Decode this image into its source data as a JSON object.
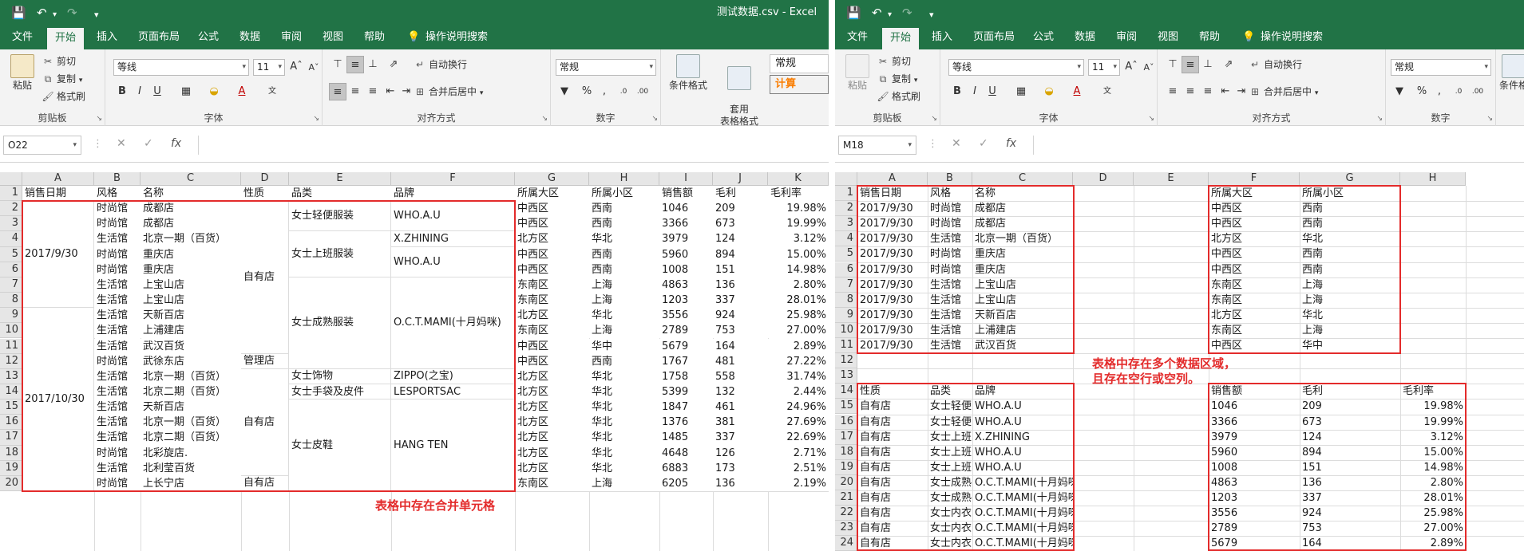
{
  "left": {
    "app_title": "测试数据.csv  -  Excel",
    "tabs": [
      "文件",
      "开始",
      "插入",
      "页面布局",
      "公式",
      "数据",
      "审阅",
      "视图",
      "帮助"
    ],
    "tell_me": "操作说明搜索",
    "clipboard": {
      "paste": "粘贴",
      "cut": "剪切",
      "copy": "复制",
      "painter": "格式刷",
      "label": "剪贴板"
    },
    "font": {
      "name": "等线",
      "size": "11",
      "label": "字体"
    },
    "alignment": {
      "wrap": "自动换行",
      "merge": "合并后居中",
      "label": "对齐方式"
    },
    "number": {
      "format": "常规",
      "label": "数字"
    },
    "styles": {
      "conditional": "条件格式",
      "table": "套用\n表格格式",
      "style1": "常规",
      "style2": "计算"
    },
    "namebox": "O22",
    "columns": [
      "A",
      "B",
      "C",
      "D",
      "E",
      "F",
      "G",
      "H",
      "I",
      "J",
      "K"
    ],
    "rows": [
      "1",
      "2",
      "3",
      "4",
      "5",
      "6",
      "7",
      "8",
      "9",
      "10",
      "11",
      "12",
      "13",
      "14",
      "15",
      "16",
      "17",
      "18",
      "19",
      "20"
    ],
    "headers": [
      "销售日期",
      "风格",
      "名称",
      "性质",
      "品类",
      "品牌",
      "所属大区",
      "所属小区",
      "销售额",
      "毛利",
      "毛利率"
    ],
    "merged_a": [
      "2017/9/30",
      "2017/10/30"
    ],
    "merged_d": [
      "自有店",
      "管理店",
      "自有店",
      "自有店"
    ],
    "merged_e": [
      "女士轻便服装",
      "女士上班服装",
      "女士成熟服装",
      "女士饰物",
      "女士手袋及皮件",
      "女士皮鞋"
    ],
    "merged_f": [
      "WHO.A.U",
      "X.ZHINING",
      "WHO.A.U",
      "O.C.T.MAMI(十月妈咪)",
      "ZIPPO(之宝)",
      "LESPORTSAC",
      "HANG TEN"
    ],
    "style_col": [
      "时尚馆",
      "时尚馆",
      "生活馆",
      "时尚馆",
      "时尚馆",
      "生活馆",
      "生活馆",
      "生活馆",
      "生活馆",
      "生活馆",
      "时尚馆",
      "生活馆",
      "生活馆",
      "生活馆",
      "生活馆",
      "生活馆",
      "时尚馆",
      "生活馆",
      "时尚馆"
    ],
    "name_col": [
      "成都店",
      "成都店",
      "北京一期（百货）",
      "重庆店",
      "重庆店",
      "上宝山店",
      "上宝山店",
      "天新百店",
      "上浦建店",
      "武汉百货",
      "武徐东店",
      "北京一期（百货）",
      "北京二期（百货）",
      "天新百店",
      "北京一期（百货）",
      "北京二期（百货）",
      "北彩旋店.",
      "北利莹百货",
      "上长宁店"
    ],
    "region_col": [
      "中西区",
      "中西区",
      "北方区",
      "中西区",
      "中西区",
      "东南区",
      "东南区",
      "北方区",
      "东南区",
      "中西区",
      "中西区",
      "北方区",
      "北方区",
      "北方区",
      "北方区",
      "北方区",
      "北方区",
      "北方区",
      "东南区"
    ],
    "subregion_col": [
      "西南",
      "西南",
      "华北",
      "西南",
      "西南",
      "上海",
      "上海",
      "华北",
      "上海",
      "华中",
      "西南",
      "华北",
      "华北",
      "华北",
      "华北",
      "华北",
      "华北",
      "华北",
      "上海"
    ],
    "sales_col": [
      "1046",
      "3366",
      "3979",
      "5960",
      "1008",
      "4863",
      "1203",
      "3556",
      "2789",
      "5679",
      "1767",
      "1758",
      "5399",
      "1847",
      "1376",
      "1485",
      "4648",
      "6883",
      "6205"
    ],
    "profit_col": [
      "209",
      "673",
      "124",
      "894",
      "151",
      "136",
      "337",
      "924",
      "753",
      "164",
      "481",
      "558",
      "132",
      "461",
      "381",
      "337",
      "126",
      "173",
      "136"
    ],
    "rate_col": [
      "19.98%",
      "19.99%",
      "3.12%",
      "15.00%",
      "14.98%",
      "2.80%",
      "28.01%",
      "25.98%",
      "27.00%",
      "2.89%",
      "27.22%",
      "31.74%",
      "2.44%",
      "24.96%",
      "27.69%",
      "22.69%",
      "2.71%",
      "2.51%",
      "2.19%"
    ],
    "note": "表格中存在合并单元格"
  },
  "right": {
    "tabs": [
      "文件",
      "开始",
      "插入",
      "页面布局",
      "公式",
      "数据",
      "审阅",
      "视图",
      "帮助"
    ],
    "tell_me": "操作说明搜索",
    "clipboard": {
      "paste": "粘贴",
      "cut": "剪切",
      "copy": "复制",
      "painter": "格式刷",
      "label": "剪贴板"
    },
    "font": {
      "name": "等线",
      "size": "11",
      "label": "字体"
    },
    "alignment": {
      "wrap": "自动换行",
      "merge": "合并后居中",
      "label": "对齐方式"
    },
    "number": {
      "format": "常规",
      "label": "数字"
    },
    "styles": {
      "conditional": "条件格",
      "label": ""
    },
    "namebox": "M18",
    "columns": [
      "A",
      "B",
      "C",
      "D",
      "E",
      "F",
      "G",
      "H"
    ],
    "rows": [
      "1",
      "2",
      "3",
      "4",
      "5",
      "6",
      "7",
      "8",
      "9",
      "10",
      "11",
      "12",
      "13",
      "14",
      "15",
      "16",
      "17",
      "18",
      "19",
      "20",
      "21",
      "22",
      "23",
      "24"
    ],
    "top_headers": [
      "销售日期",
      "风格",
      "名称"
    ],
    "top_dates": [
      "2017/9/30",
      "2017/9/30",
      "2017/9/30",
      "2017/9/30",
      "2017/9/30",
      "2017/9/30",
      "2017/9/30",
      "2017/9/30",
      "2017/9/30",
      "2017/9/30"
    ],
    "top_styles": [
      "时尚馆",
      "时尚馆",
      "生活馆",
      "时尚馆",
      "时尚馆",
      "生活馆",
      "生活馆",
      "生活馆",
      "生活馆",
      "生活馆"
    ],
    "top_names": [
      "成都店",
      "成都店",
      "北京一期（百货）",
      "重庆店",
      "重庆店",
      "上宝山店",
      "上宝山店",
      "天新百店",
      "上浦建店",
      "武汉百货"
    ],
    "region_headers": [
      "所属大区",
      "所属小区"
    ],
    "regions": [
      "中西区",
      "中西区",
      "北方区",
      "中西区",
      "中西区",
      "东南区",
      "东南区",
      "北方区",
      "东南区",
      "中西区"
    ],
    "subregions": [
      "西南",
      "西南",
      "华北",
      "西南",
      "西南",
      "上海",
      "上海",
      "华北",
      "上海",
      "华中"
    ],
    "bottom_headers": [
      "性质",
      "品类",
      "品牌"
    ],
    "natures": [
      "自有店",
      "自有店",
      "自有店",
      "自有店",
      "自有店",
      "自有店",
      "自有店",
      "自有店",
      "自有店",
      "自有店"
    ],
    "categories": [
      "女士轻便",
      "女士轻便",
      "女士上班",
      "女士上班",
      "女士上班",
      "女士成熟",
      "女士成熟",
      "女士内衣",
      "女士内衣",
      "女士内衣"
    ],
    "brands": [
      "WHO.A.U",
      "WHO.A.U",
      "X.ZHINING",
      "WHO.A.U",
      "WHO.A.U",
      "O.C.T.MAMI(十月妈咪)",
      "O.C.T.MAMI(十月妈咪)",
      "O.C.T.MAMI(十月妈咪)",
      "O.C.T.MAMI(十月妈咪)",
      "O.C.T.MAMI(十月妈咪)"
    ],
    "sales_headers": [
      "销售额",
      "毛利",
      "毛利率"
    ],
    "sales": [
      "1046",
      "3366",
      "3979",
      "5960",
      "1008",
      "4863",
      "1203",
      "3556",
      "2789",
      "5679"
    ],
    "profits": [
      "209",
      "673",
      "124",
      "894",
      "151",
      "136",
      "337",
      "924",
      "753",
      "164"
    ],
    "rates": [
      "19.98%",
      "19.99%",
      "3.12%",
      "15.00%",
      "14.98%",
      "2.80%",
      "28.01%",
      "25.98%",
      "27.00%",
      "2.89%"
    ],
    "note_line1": "表格中存在多个数据区域，",
    "note_line2": "且存在空行或空列。"
  },
  "colors": {
    "excel_green": "#217346",
    "red": "#e32b2b",
    "ribbon_bg": "#f3f3f3"
  }
}
